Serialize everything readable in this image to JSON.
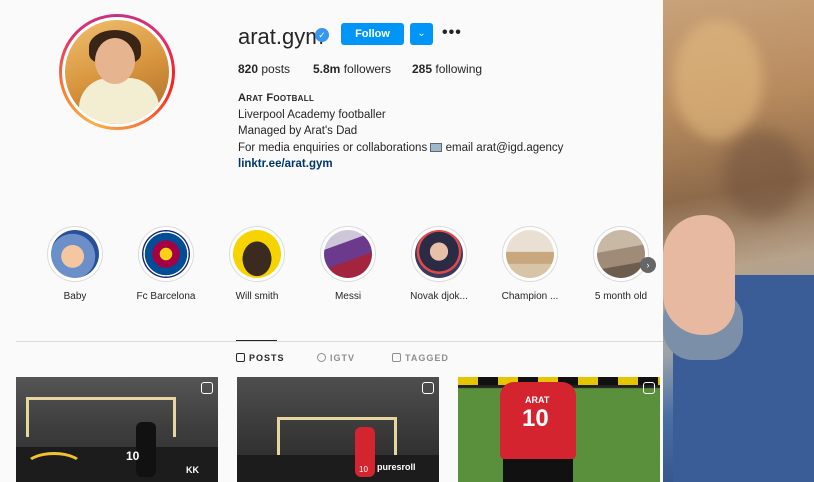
{
  "profile": {
    "username": "arat.gym",
    "follow_label": "Follow",
    "dropdown_icon": "chevron-down-icon",
    "more_label": "•••",
    "stats": {
      "posts_count": "820",
      "posts_label": "posts",
      "followers_count": "5.8m",
      "followers_label": "followers",
      "following_count": "285",
      "following_label": "following"
    },
    "bio": {
      "name": "Arat Football",
      "line1": "Liverpool Academy footballer",
      "line2": "Managed by Arat's Dad",
      "line3_prefix": "For media enquiries or collaborations",
      "line3_suffix": "email arat@igd.agency",
      "link": "linktr.ee/arat.gym"
    }
  },
  "highlights": [
    {
      "label": "Baby"
    },
    {
      "label": "Fc Barcelona"
    },
    {
      "label": "Will smith"
    },
    {
      "label": "Messi"
    },
    {
      "label": "Novak djok..."
    },
    {
      "label": "Champion ..."
    },
    {
      "label": "5 month old"
    }
  ],
  "tabs": [
    {
      "label": "POSTS",
      "active": true
    },
    {
      "label": "IGTV",
      "active": false
    },
    {
      "label": "TAGGED",
      "active": false
    }
  ],
  "posts": [
    {
      "number": "10",
      "banner": "KK"
    },
    {
      "number": "10",
      "banner": "puresroll"
    },
    {
      "number": "10",
      "name": "ARAT"
    }
  ],
  "colors": {
    "accent": "#0095f6",
    "link": "#00376b",
    "jersey": "#d3242f"
  }
}
